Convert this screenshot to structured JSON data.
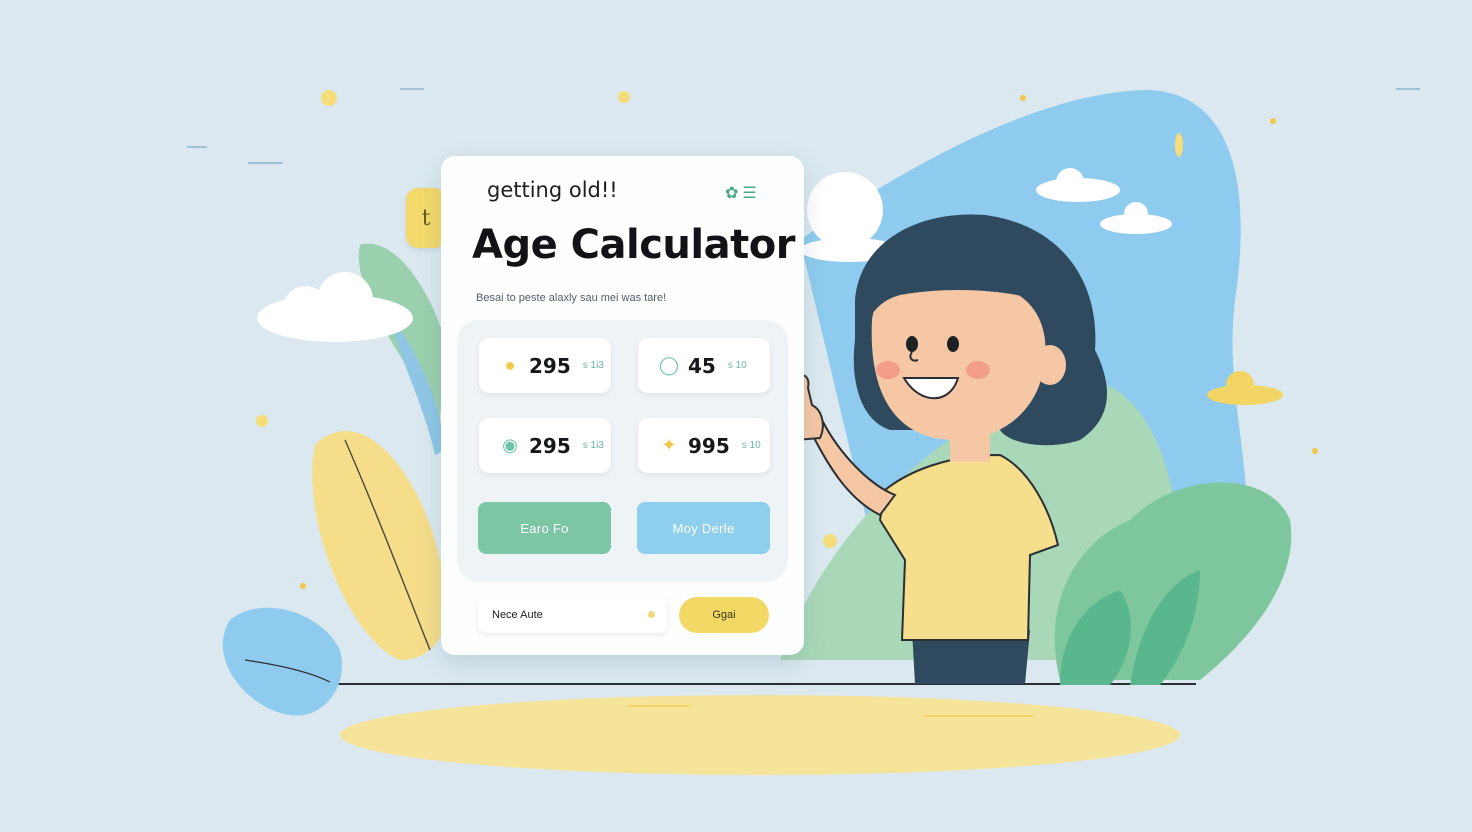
{
  "card": {
    "tab_icon": "t",
    "subtitle": "getting old!!",
    "menu_icons": [
      "flower-icon",
      "menu-icon"
    ],
    "title": "Age Calculator",
    "description": "Besai to peste alaxly sau mei was tare!"
  },
  "stats": [
    {
      "icon": "drop-icon",
      "value": "295",
      "unit": "s 1i3",
      "icon_color": "#f2c84b"
    },
    {
      "icon": "ring-icon",
      "value": "45",
      "unit": "s 10",
      "icon_color": "#6cc4a8"
    },
    {
      "icon": "leaf-icon",
      "value": "295",
      "unit": "s 1i3",
      "icon_color": "#6cc4a8"
    },
    {
      "icon": "spark-icon",
      "value": "995",
      "unit": "s 10",
      "icon_color": "#f2c84b"
    }
  ],
  "buttons": {
    "primary_label": "Earo Fo",
    "secondary_label": "Moy Derle"
  },
  "input": {
    "value": "Nece Aute"
  },
  "search_button": {
    "label": "Ggai"
  },
  "colors": {
    "background": "#dbe8ef",
    "accent_yellow": "#f2d865",
    "accent_green": "#7cc6a6",
    "accent_blue": "#8ecfee"
  }
}
